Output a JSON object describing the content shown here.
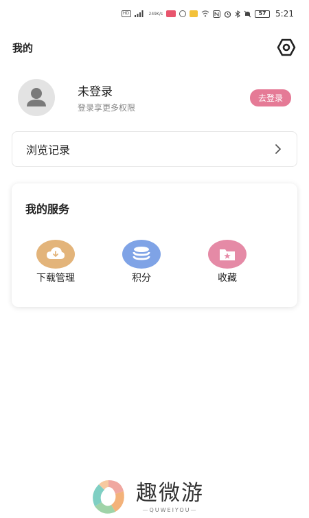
{
  "status_bar": {
    "hd": "HD",
    "signal": "4G",
    "speed_top": "249",
    "speed_bottom": "K/s",
    "battery": "57",
    "time": "5:21"
  },
  "header": {
    "title": "我的"
  },
  "profile": {
    "name": "未登录",
    "subtitle": "登录享更多权限",
    "login_button": "去登录"
  },
  "history": {
    "label": "浏览记录"
  },
  "services": {
    "title": "我的服务",
    "items": [
      {
        "label": "下载管理",
        "icon": "cloud-download-icon",
        "color": "#e3b47a"
      },
      {
        "label": "积分",
        "icon": "database-coins-icon",
        "color": "#7fa3e6"
      },
      {
        "label": "收藏",
        "icon": "star-folder-icon",
        "color": "#e58aa6"
      }
    ]
  },
  "footer": {
    "brand_cn": "趣微游",
    "brand_en": "QUWEIYOU"
  },
  "colors": {
    "accent_pink": "#e57a96",
    "download_bg": "#e3b47a",
    "points_bg": "#7fa3e6",
    "favorite_bg": "#e58aa6"
  }
}
